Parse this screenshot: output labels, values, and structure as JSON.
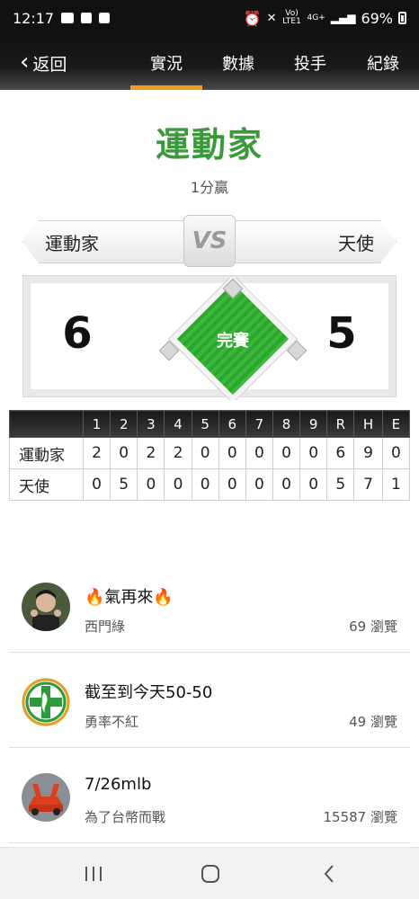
{
  "status_bar": {
    "time": "12:17",
    "battery_percent": "69%",
    "volte": "Vo) LTE1",
    "network": "4G+"
  },
  "nav": {
    "back_label": "返回",
    "tabs": [
      {
        "label": "實況",
        "active": true
      },
      {
        "label": "數據",
        "active": false
      },
      {
        "label": "投手",
        "active": false
      },
      {
        "label": "紀錄",
        "active": false
      }
    ]
  },
  "game": {
    "winner_title": "運動家",
    "result_text": "1分贏",
    "home_team": "運動家",
    "away_team": "天使",
    "vs_label": "VS",
    "home_score": "6",
    "away_score": "5",
    "status": "完賽"
  },
  "linescore": {
    "headers": [
      "1",
      "2",
      "3",
      "4",
      "5",
      "6",
      "7",
      "8",
      "9",
      "R",
      "H",
      "E"
    ],
    "rows": [
      {
        "team": "運動家",
        "values": [
          "2",
          "0",
          "2",
          "2",
          "0",
          "0",
          "0",
          "0",
          "0",
          "6",
          "9",
          "0"
        ]
      },
      {
        "team": "天使",
        "values": [
          "0",
          "5",
          "0",
          "0",
          "0",
          "0",
          "0",
          "0",
          "0",
          "5",
          "7",
          "1"
        ]
      }
    ]
  },
  "posts": [
    {
      "title": "🔥氣再來🔥",
      "author": "西門綠",
      "views": "69 瀏覽"
    },
    {
      "title": "截至到今天50-50",
      "author": "勇率不紅",
      "views": "49 瀏覽"
    },
    {
      "title": "7/26mlb",
      "author": "為了台幣而戰",
      "views": "15587 瀏覽"
    }
  ],
  "colors": {
    "accent": "#f39a1a",
    "winner_green": "#3a9a3a",
    "field_green": "#2ea52e"
  }
}
